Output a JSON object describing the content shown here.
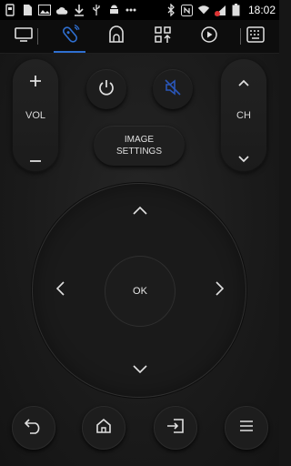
{
  "status_bar": {
    "time": "18:02",
    "left_icons": [
      "flashlight-icon",
      "sd-card-icon",
      "image-icon",
      "cloud-icon",
      "download-icon",
      "usb-icon",
      "android-icon",
      "more-icon"
    ],
    "right_icons": [
      "bluetooth-icon",
      "nfc-icon",
      "wifi-icon",
      "signal-icon",
      "battery-icon"
    ]
  },
  "tabs": [
    {
      "name": "tv",
      "icon": "tv-icon"
    },
    {
      "name": "remote",
      "icon": "remote-icon",
      "active": true
    },
    {
      "name": "cast",
      "icon": "cast-icon"
    },
    {
      "name": "apps",
      "icon": "apps-icon"
    },
    {
      "name": "play",
      "icon": "play-icon"
    },
    {
      "name": "keyboard",
      "icon": "keyboard-icon"
    }
  ],
  "remote": {
    "vol_label": "VOL",
    "ch_label": "CH",
    "image_settings_line1": "IMAGE",
    "image_settings_line2": "SETTINGS",
    "ok_label": "OK"
  },
  "colors": {
    "accent": "#2f6fd0",
    "mute_icon": "#2a56b8"
  }
}
